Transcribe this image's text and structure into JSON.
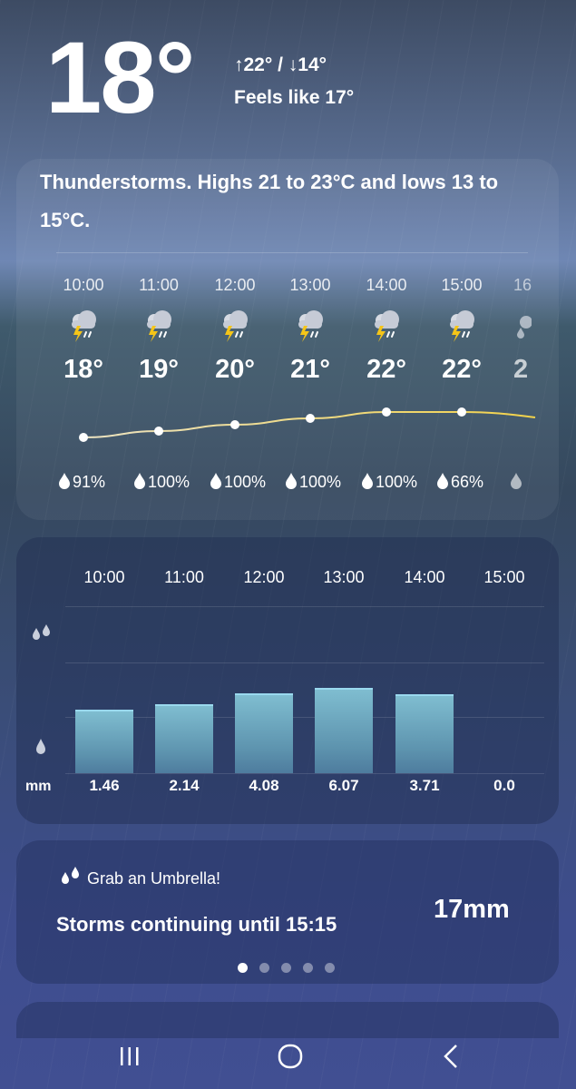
{
  "current": {
    "temp": "18°",
    "hilo": "↑22° / ↓14°",
    "feels_like": "Feels like 17°"
  },
  "summary": "Thunderstorms. Highs 21 to 23°C and lows 13 to 15°C.",
  "hourly": [
    {
      "time": "10:00",
      "temp": "18°",
      "precip": "91%",
      "icon": "thunderstorm-icon"
    },
    {
      "time": "11:00",
      "temp": "19°",
      "precip": "100%",
      "icon": "thunderstorm-icon"
    },
    {
      "time": "12:00",
      "temp": "20°",
      "precip": "100%",
      "icon": "thunderstorm-icon"
    },
    {
      "time": "13:00",
      "temp": "21°",
      "precip": "100%",
      "icon": "thunderstorm-icon"
    },
    {
      "time": "14:00",
      "temp": "22°",
      "precip": "100%",
      "icon": "thunderstorm-icon"
    },
    {
      "time": "15:00",
      "temp": "22°",
      "precip": "66%",
      "icon": "thunderstorm-icon"
    },
    {
      "time": "16",
      "temp": "2",
      "precip": "",
      "icon": "rain-icon"
    }
  ],
  "rainfall": {
    "unit": "mm",
    "times": [
      "10:00",
      "11:00",
      "12:00",
      "13:00",
      "14:00",
      "15:00"
    ],
    "values": [
      "1.46",
      "2.14",
      "4.08",
      "6.07",
      "3.71",
      "0.0"
    ],
    "levels": [
      0.62,
      0.67,
      0.78,
      0.83,
      0.77,
      0
    ]
  },
  "umbrella": {
    "title": "Grab an Umbrella!",
    "text": "Storms continuing until 15:15",
    "amount": "17mm",
    "pages": 5,
    "active_page": 1
  },
  "colors": {
    "bar": "#7fbdd0",
    "temp_line": "#f2d24a"
  }
}
